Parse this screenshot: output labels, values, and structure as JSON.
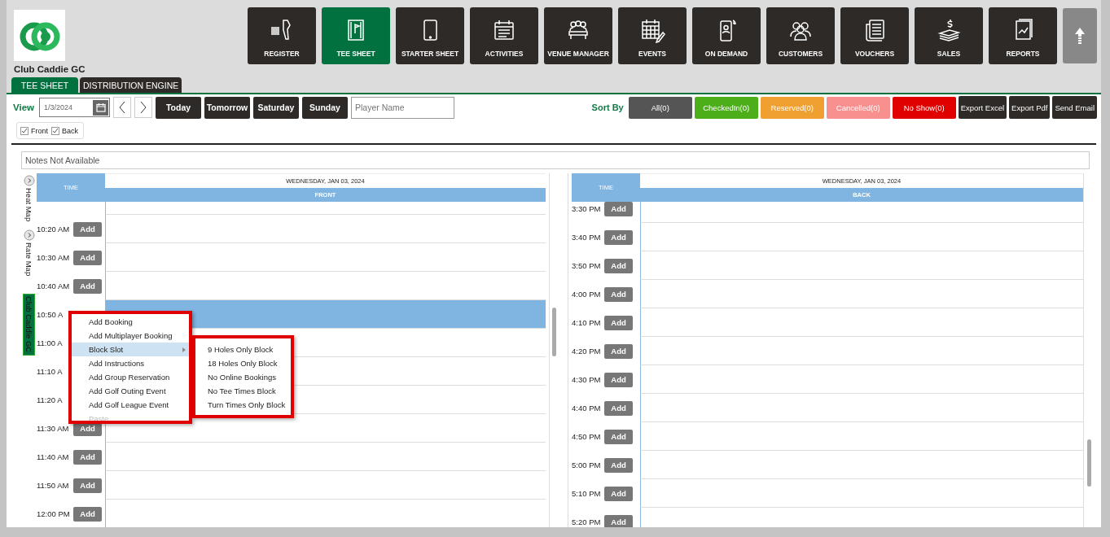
{
  "brand": {
    "name": "Club Caddie GC"
  },
  "nav": [
    {
      "label": "REGISTER",
      "selected": false
    },
    {
      "label": "TEE SHEET",
      "selected": true
    },
    {
      "label": "STARTER SHEET",
      "selected": false
    },
    {
      "label": "ACTIVITIES",
      "selected": false
    },
    {
      "label": "VENUE MANAGER",
      "selected": false
    },
    {
      "label": "EVENTS",
      "selected": false
    },
    {
      "label": "ON DEMAND",
      "selected": false
    },
    {
      "label": "CUSTOMERS",
      "selected": false
    },
    {
      "label": "VOUCHERS",
      "selected": false
    },
    {
      "label": "SALES",
      "selected": false
    },
    {
      "label": "REPORTS",
      "selected": false
    }
  ],
  "tabs": [
    {
      "label": "TEE SHEET",
      "selected": true
    },
    {
      "label": "DISTRIBUTION ENGINE",
      "selected": false
    }
  ],
  "toolbar": {
    "view_label": "View",
    "date": "1/3/2024",
    "quick_days": [
      "Today",
      "Tomorrow",
      "Saturday",
      "Sunday"
    ],
    "player_search": {
      "placeholder": "Player Name"
    },
    "sort_label": "Sort By",
    "filters": [
      {
        "label": "All(0)",
        "color": "#555555"
      },
      {
        "label": "CheckedIn(0)",
        "color": "#4caf1a"
      },
      {
        "label": "Reserved(0)",
        "color": "#f0a030"
      },
      {
        "label": "Cancelled(0)",
        "color": "#f89090"
      },
      {
        "label": "No Show(0)",
        "color": "#e00000"
      }
    ],
    "exports": [
      "Export Excel",
      "Export Pdf",
      "Send Email"
    ]
  },
  "course_filters": [
    {
      "label": "Front",
      "checked": true
    },
    {
      "label": "Back",
      "checked": true
    }
  ],
  "notes": {
    "placeholder": "Notes Not Available"
  },
  "side_tabs": [
    {
      "label": "Heat Map",
      "kind": "toggle",
      "selected": false
    },
    {
      "label": "Rate Map",
      "kind": "toggle",
      "selected": false
    },
    {
      "label": "Club Caddie GC",
      "kind": "badge",
      "selected": true
    }
  ],
  "panels": [
    {
      "time_header": "TIME",
      "date": "WEDNESDAY, JAN 03, 2024",
      "course": "FRONT",
      "rows": [
        {
          "time": "10:20 AM",
          "action": "Add",
          "selected": false
        },
        {
          "time": "10:30 AM",
          "action": "Add",
          "selected": false
        },
        {
          "time": "10:40 AM",
          "action": "Add",
          "selected": false
        },
        {
          "time": "10:50 A",
          "selected": true
        },
        {
          "time": "11:00 A",
          "selected": false
        },
        {
          "time": "11:10 A",
          "selected": false
        },
        {
          "time": "11:20 A",
          "selected": false
        },
        {
          "time": "11:30 AM",
          "action": "Add",
          "selected": false
        },
        {
          "time": "11:40 AM",
          "action": "Add",
          "selected": false
        },
        {
          "time": "11:50 AM",
          "action": "Add",
          "selected": false
        },
        {
          "time": "12:00 PM",
          "action": "Add",
          "selected": false
        }
      ]
    },
    {
      "time_header": "TIME",
      "date": "WEDNESDAY, JAN 03, 2024",
      "course": "BACK",
      "rows": [
        {
          "time": "3:30 PM",
          "action": "Add",
          "selected": false
        },
        {
          "time": "3:40 PM",
          "action": "Add",
          "selected": false
        },
        {
          "time": "3:50 PM",
          "action": "Add",
          "selected": false
        },
        {
          "time": "4:00 PM",
          "action": "Add",
          "selected": false
        },
        {
          "time": "4:10 PM",
          "action": "Add",
          "selected": false
        },
        {
          "time": "4:20 PM",
          "action": "Add",
          "selected": false
        },
        {
          "time": "4:30 PM",
          "action": "Add",
          "selected": false
        },
        {
          "time": "4:40 PM",
          "action": "Add",
          "selected": false
        },
        {
          "time": "4:50 PM",
          "action": "Add",
          "selected": false
        },
        {
          "time": "5:00 PM",
          "action": "Add",
          "selected": false
        },
        {
          "time": "5:10 PM",
          "action": "Add",
          "selected": false
        },
        {
          "time": "5:20 PM",
          "action": "Add",
          "selected": false
        }
      ]
    }
  ],
  "context_menu": {
    "items": [
      {
        "label": "Add Booking",
        "highlighted": false,
        "disabled": false,
        "has_submenu": false
      },
      {
        "label": "Add Multiplayer Booking",
        "highlighted": false,
        "disabled": false,
        "has_submenu": false
      },
      {
        "label": "Block Slot",
        "highlighted": true,
        "disabled": false,
        "has_submenu": true
      },
      {
        "label": "Add Instructions",
        "highlighted": false,
        "disabled": false,
        "has_submenu": false
      },
      {
        "label": "Add Group Reservation",
        "highlighted": false,
        "disabled": false,
        "has_submenu": false
      },
      {
        "label": "Add Golf Outing Event",
        "highlighted": false,
        "disabled": false,
        "has_submenu": false
      },
      {
        "label": "Add Golf League Event",
        "highlighted": false,
        "disabled": false,
        "has_submenu": false
      },
      {
        "label": "Paste",
        "highlighted": false,
        "disabled": true,
        "has_submenu": false
      }
    ],
    "submenu": [
      "9 Holes Only Block",
      "18 Holes Only Block",
      "No Online Bookings",
      "No Tee Times Block",
      "Turn Times Only Block"
    ]
  }
}
